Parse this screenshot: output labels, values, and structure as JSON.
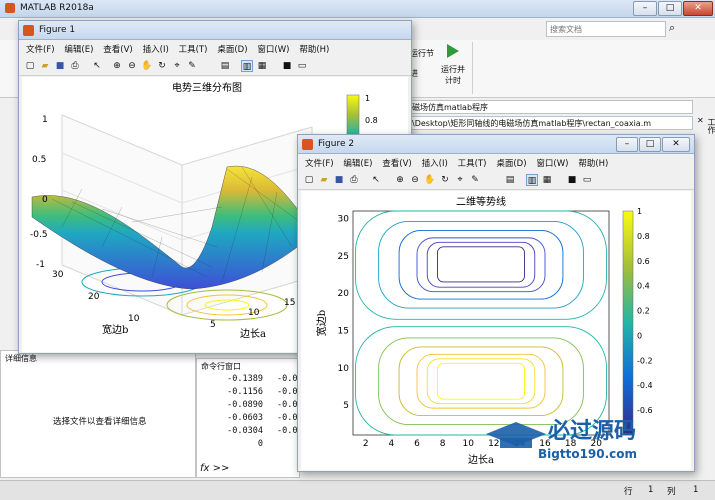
{
  "main": {
    "title": "MATLAB R2018a",
    "search_placeholder": "搜索文档",
    "toolstrip": {
      "run_section": "运行节",
      "advance": "进",
      "run_advance": "运行并\n计时"
    },
    "address": "磁场仿真matlab程序",
    "path": "\\Desktop\\矩形同轴线的电磁场仿真matlab程序\\rectan_coaxia.m",
    "left_panel_header": "详细信息",
    "left_panel_text": "选择文件以查看详细信息",
    "cmd_header": "命令行窗口",
    "cmd_values": [
      "-0.1389",
      "-0.1156",
      "-0.0890",
      "-0.0603",
      "-0.0304",
      "0"
    ],
    "cmd_values_col2": [
      "-0.0",
      "-0.0",
      "-0.0",
      "-0.0",
      "-0.0"
    ],
    "cmd_prompt": "fx >>",
    "status_row_label": "行",
    "status_row": "1",
    "status_col_label": "列",
    "status_col": "1"
  },
  "figure1": {
    "title": "Figure 1",
    "menu": [
      "文件(F)",
      "编辑(E)",
      "查看(V)",
      "插入(I)",
      "工具(T)",
      "桌面(D)",
      "窗口(W)",
      "帮助(H)"
    ],
    "plot_title": "电势三维分布图",
    "xlabel": "边长a",
    "ylabel": "宽边b",
    "z_ticks": [
      "1",
      "0.5",
      "0",
      "-0.5",
      "-1"
    ],
    "y_ticks": [
      "30",
      "20",
      "10"
    ],
    "x_ticks": [
      "5",
      "10",
      "15"
    ],
    "colorbar_ticks": [
      "1",
      "0.8"
    ]
  },
  "figure2": {
    "title": "Figure 2",
    "menu": [
      "文件(F)",
      "编辑(E)",
      "查看(V)",
      "插入(I)",
      "工具(T)",
      "桌面(D)",
      "窗口(W)",
      "帮助(H)"
    ],
    "plot_title": "二维等势线",
    "xlabel": "边长a",
    "ylabel": "宽边b",
    "y_ticks": [
      "30",
      "25",
      "20",
      "15",
      "10",
      "5"
    ],
    "x_ticks": [
      "2",
      "4",
      "6",
      "8",
      "10",
      "12",
      "14",
      "16",
      "18",
      "20"
    ],
    "colorbar_ticks": [
      "1",
      "0.8",
      "0.6",
      "0.4",
      "0.2",
      "0",
      "-0.2",
      "-0.4",
      "-0.6"
    ]
  },
  "watermark": {
    "text": "必过源码",
    "url": "Bigtto190.com"
  },
  "colors": {
    "parula_low": "#352a87",
    "parula_mid": "#21b5a6",
    "parula_high": "#f9fb0e",
    "title_bar": "#c6d8ee"
  },
  "chart_data": [
    {
      "type": "surface",
      "title": "电势三维分布图",
      "xlabel": "边长a",
      "ylabel": "宽边b",
      "zlim": [
        -1,
        1
      ],
      "colormap": "parula",
      "z_ticks": [
        1,
        0.5,
        0,
        -0.5,
        -1
      ]
    },
    {
      "type": "contour",
      "title": "二维等势线",
      "xlabel": "边长a",
      "ylabel": "宽边b",
      "xlim": [
        1,
        21
      ],
      "ylim": [
        1,
        31
      ],
      "colorbar_range": [
        -0.8,
        1
      ],
      "colormap": "parula"
    }
  ]
}
